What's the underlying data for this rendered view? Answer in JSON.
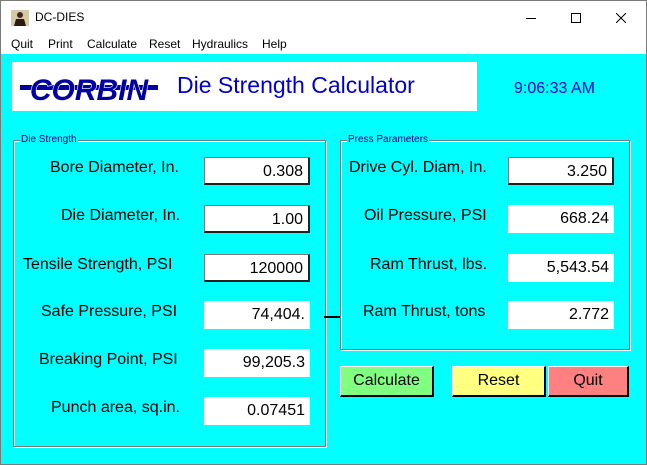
{
  "window": {
    "title": "DC-DIES"
  },
  "menu": [
    "Quit",
    "Print",
    "Calculate",
    "Reset",
    "Hydraulics",
    "Help"
  ],
  "header": {
    "app_title": "Die Strength Calculator",
    "clock": "9:06:33 AM",
    "logo_text": "CORBIN"
  },
  "die_strength": {
    "legend": "Die Strength",
    "bore_label": "Bore Diameter, In.",
    "bore_value": "0.308",
    "die_label": "Die Diameter, In.",
    "die_value": "1.00",
    "tensile_label": "Tensile Strength, PSI",
    "tensile_value": "120000",
    "safe_label": "Safe Pressure, PSI",
    "safe_value": "74,404.",
    "breaking_label": "Breaking Point, PSI",
    "breaking_value": "99,205.3",
    "punch_label": "Punch area, sq.in.",
    "punch_value": "0.07451"
  },
  "press": {
    "legend": "Press Parameters",
    "drive_label": "Drive Cyl. Diam, In.",
    "drive_value": "3.250",
    "oil_label": "Oil Pressure, PSI",
    "oil_value": "668.24",
    "thrust_lbs_label": "Ram Thrust, lbs.",
    "thrust_lbs_value": "5,543.54",
    "thrust_tons_label": "Ram Thrust, tons",
    "thrust_tons_value": "2.772"
  },
  "buttons": {
    "calculate": "Calculate",
    "reset": "Reset",
    "quit": "Quit"
  },
  "colors": {
    "background": "#00ffff",
    "title_blue": "#0000c8",
    "calculate": "#80ff80",
    "reset": "#ffff80",
    "quit": "#ff8080"
  }
}
